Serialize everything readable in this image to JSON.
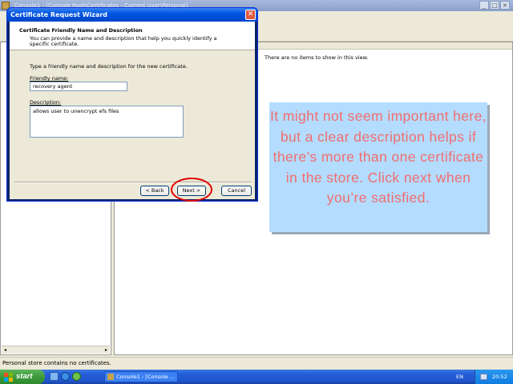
{
  "console": {
    "title": "Console1 - [Console Root\\Certificates - Current User\\Personal]",
    "status_text": "Personal store contains no certificates.",
    "empty_message": "There are no items to show in this view."
  },
  "dialog": {
    "title": "Certificate Request Wizard",
    "close_glyph": "✕",
    "heading": "Certificate Friendly Name and Description",
    "subheading": "You can provide a name and description that help you quickly identify a specific certificate.",
    "prompt": "Type a friendly name and description for the new certificate.",
    "friendly_name_label": "Friendly name:",
    "friendly_name_value": "recovery agent",
    "description_label": "Description:",
    "description_value": "allows user to unencrypt efs files",
    "buttons": {
      "back": "< Back",
      "next": "Next >",
      "cancel": "Cancel"
    }
  },
  "callout": {
    "text": "It might not seem important here, but  a clear description helps if there’s more than one certificate in the store. Click next when you’re satisfied."
  },
  "taskbar": {
    "start_label": "start",
    "task_item": "Console1 - [Console ...",
    "language": "EN",
    "clock": "20:52"
  },
  "colors": {
    "callout_bg": "#b3dcff",
    "callout_text": "#f26d6d",
    "highlight_ring": "#e00000",
    "xp_titlebar": "#0054e3"
  }
}
